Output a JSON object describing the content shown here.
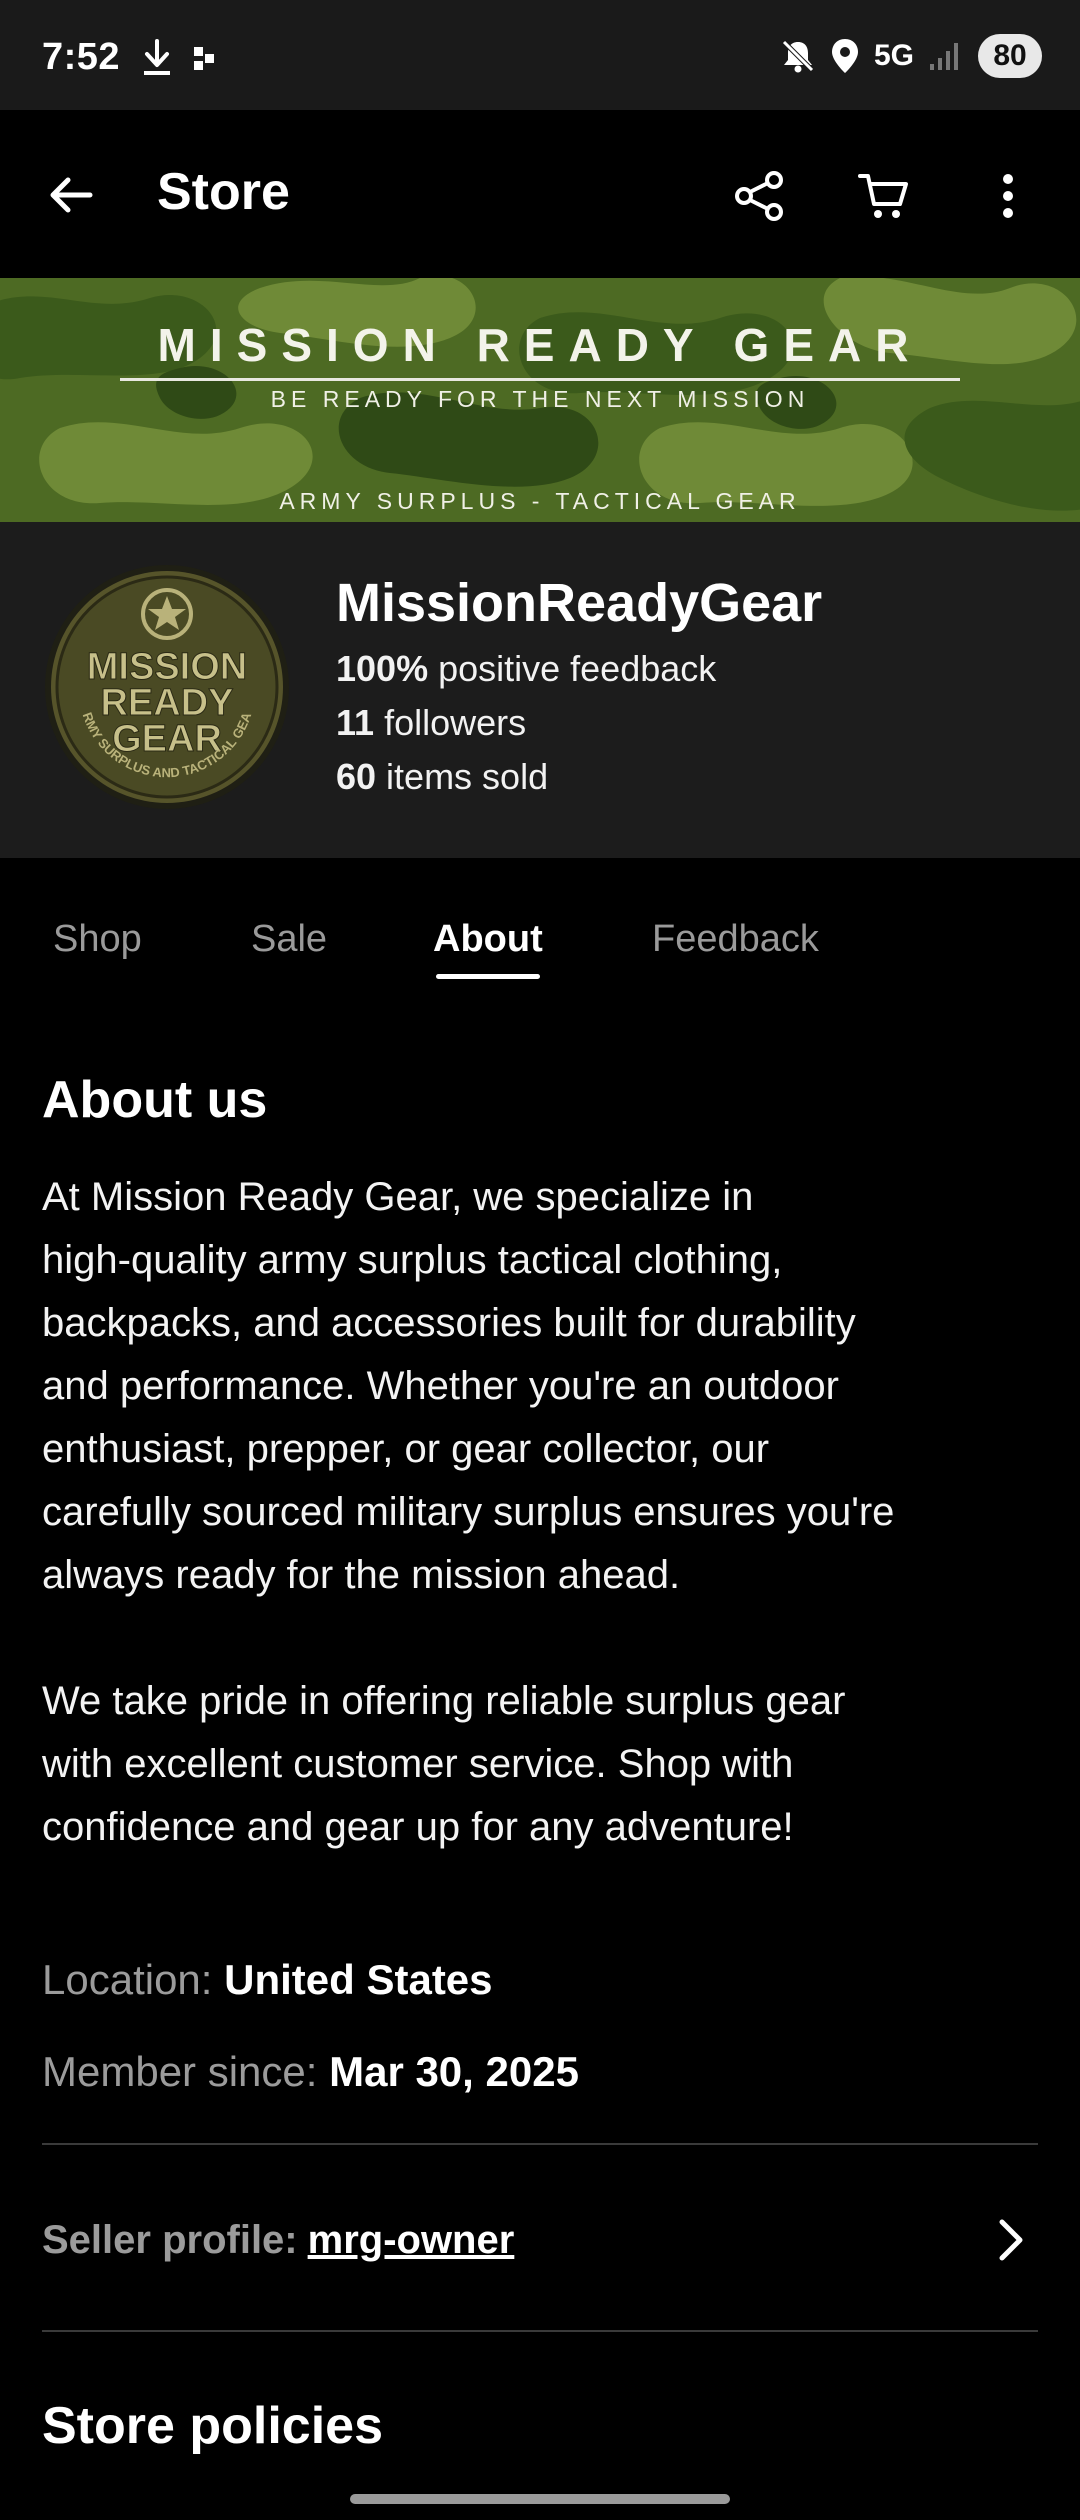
{
  "status_bar": {
    "time": "7:52",
    "network": "5G",
    "battery": "80",
    "icons": [
      "download-icon",
      "notification-dot-icon",
      "mute-icon",
      "location-icon",
      "signal-icon"
    ]
  },
  "app_bar": {
    "title": "Store",
    "icons": [
      "back-arrow-icon",
      "share-icon",
      "cart-icon",
      "more-vert-icon"
    ]
  },
  "banner": {
    "title": "MISSION READY GEAR",
    "subtitle": "BE READY FOR THE NEXT MISSION",
    "bottom_text": "ARMY SURPLUS - TACTICAL GEAR",
    "camo_colors": [
      "#4d6a23",
      "#3b5a1b",
      "#6f8a37",
      "#2f4a16"
    ]
  },
  "store": {
    "name": "MissionReadyGear",
    "feedback_value": "100%",
    "feedback_text": " positive feedback",
    "followers_value": "11",
    "followers_text": " followers",
    "sold_value": "60",
    "sold_text": " items sold",
    "logo_text_1": "MISSION",
    "logo_text_2": "READY",
    "logo_text_3": "GEAR",
    "logo_ring_text": "ARMY SURPLUS AND TACTICAL GEAR"
  },
  "tabs": [
    {
      "label": "Shop",
      "active": false
    },
    {
      "label": "Sale",
      "active": false
    },
    {
      "label": "About",
      "active": true
    },
    {
      "label": "Feedback",
      "active": false
    }
  ],
  "about": {
    "heading": "About us",
    "paragraph_1_lines": [
      "At Mission Ready Gear, we specialize in",
      "high-quality army surplus tactical clothing,",
      "backpacks, and accessories built for durability",
      "and performance. Whether you're an outdoor",
      "enthusiast, prepper, or gear collector, our",
      "carefully sourced military surplus ensures you're",
      "always ready for the mission ahead."
    ],
    "paragraph_2_lines": [
      "We take pride in offering reliable surplus gear",
      "with excellent customer service. Shop with",
      "confidence and gear up for any adventure!"
    ],
    "location_label": "Location: ",
    "location_value": "United States",
    "member_label": "Member since: ",
    "member_value": "Mar 30, 2025",
    "seller_label": "Seller profile: ",
    "seller_value": "mrg-owner",
    "policies_heading": "Store policies"
  },
  "colors": {
    "background": "#000000",
    "header_bg": "#1c1c1c",
    "muted_text": "#9b9b9b"
  }
}
